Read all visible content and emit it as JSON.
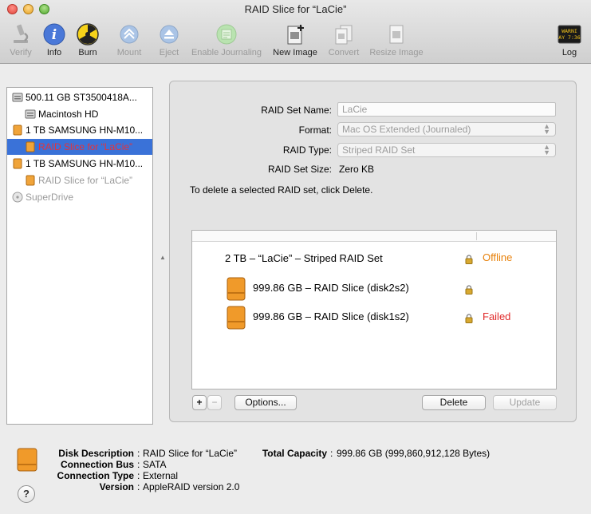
{
  "window": {
    "title": "RAID Slice for “LaCie”"
  },
  "toolbar": {
    "verify": "Verify",
    "info": "Info",
    "burn": "Burn",
    "mount": "Mount",
    "eject": "Eject",
    "enable_journaling": "Enable Journaling",
    "new_image": "New Image",
    "convert": "Convert",
    "resize_image": "Resize Image",
    "log": "Log",
    "log_icon_text_1": "WARNI",
    "log_icon_text_2": "AY 7:36"
  },
  "sidebar": {
    "items": [
      {
        "label": "500.11 GB ST3500418A...",
        "icon": "internal-disk-icon"
      },
      {
        "label": "Macintosh HD",
        "icon": "volume-icon"
      },
      {
        "label": "1 TB SAMSUNG HN-M10...",
        "icon": "external-disk-icon"
      },
      {
        "label": "RAID Slice for “LaCie”",
        "icon": "raid-slice-icon"
      },
      {
        "label": "1 TB SAMSUNG HN-M10...",
        "icon": "external-disk-icon"
      },
      {
        "label": "RAID Slice for “LaCie”",
        "icon": "raid-slice-icon"
      },
      {
        "label": "SuperDrive",
        "icon": "optical-drive-icon"
      }
    ]
  },
  "form": {
    "raid_set_name_label": "RAID Set Name:",
    "raid_set_name_value": "LaCie",
    "format_label": "Format:",
    "format_value": "Mac OS Extended (Journaled)",
    "raid_type_label": "RAID Type:",
    "raid_type_value": "Striped RAID Set",
    "raid_set_size_label": "RAID Set Size:",
    "raid_set_size_value": "Zero KB",
    "delete_hint": "To delete a selected RAID set, click Delete."
  },
  "raid_list": {
    "set_label": "2 TB – “LaCie” – Striped RAID Set",
    "set_status": "Offline",
    "members": [
      {
        "label": "999.86 GB – RAID Slice (disk2s2)",
        "status": ""
      },
      {
        "label": "999.86 GB – RAID Slice (disk1s2)",
        "status": "Failed"
      }
    ]
  },
  "buttons": {
    "add": "+",
    "remove": "−",
    "options": "Options...",
    "delete": "Delete",
    "update": "Update"
  },
  "info": {
    "disk_description_label": "Disk Description",
    "disk_description_value": "RAID Slice for “LaCie”",
    "connection_bus_label": "Connection Bus",
    "connection_bus_value": "SATA",
    "connection_type_label": "Connection Type",
    "connection_type_value": "External",
    "version_label": "Version",
    "version_value": "AppleRAID version 2.0",
    "total_capacity_label": "Total Capacity",
    "total_capacity_value": "999.86 GB (999,860,912,128 Bytes)",
    "separator": ":"
  },
  "help": {
    "label": "?"
  },
  "colors": {
    "accent_selection": "#3a72d8",
    "status_offline": "#e8820c",
    "status_failed": "#e02a2a",
    "drive_orange": "#f09a2a"
  }
}
